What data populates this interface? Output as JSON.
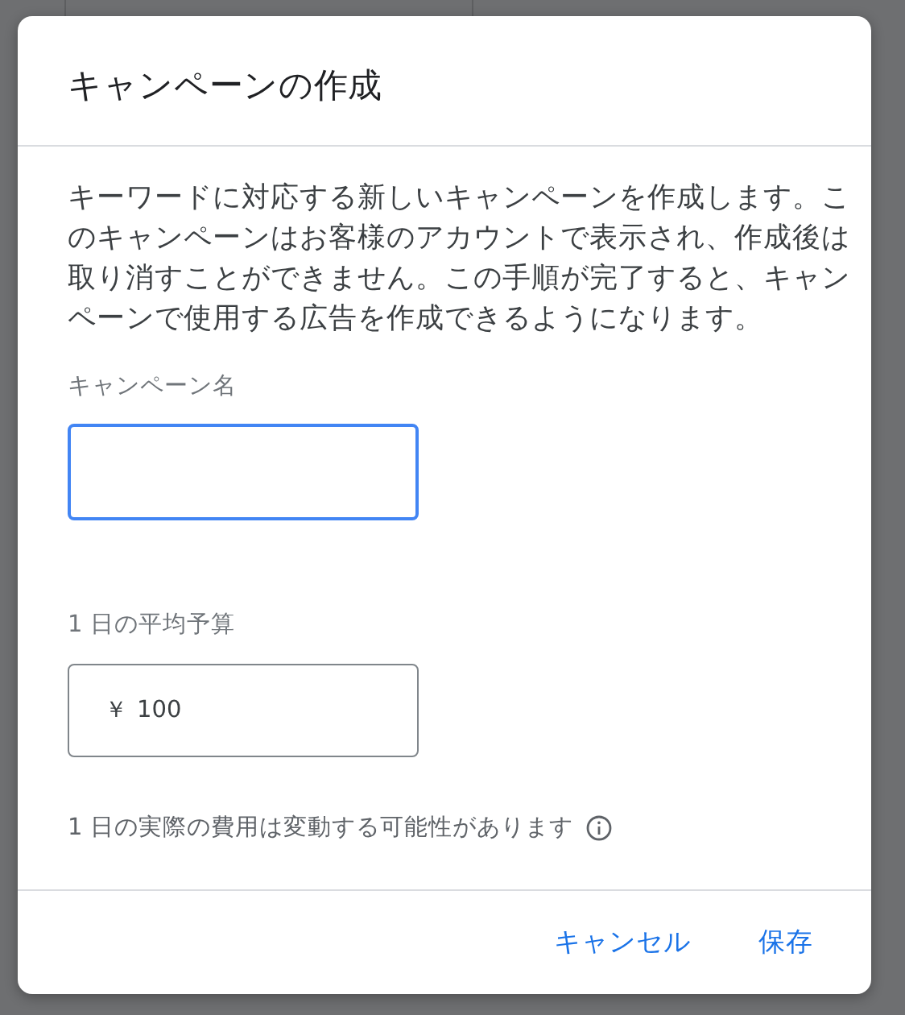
{
  "dialog": {
    "title": "キャンペーンの作成",
    "description": "キーワードに対応する新しいキャンペーンを作成します。このキャンペーンはお客様のアカウントで表示され、作成後は取り消すことができません。この手順が完了すると、キャンペーンで使用する広告を作成できるようになります。",
    "fields": [
      {
        "label": "キャンペーン名",
        "focused": true
      },
      {
        "label": "1 日の平均予算",
        "prefix": "￥",
        "value": "100",
        "focused": false
      }
    ],
    "note": "1 日の実際の費用は変動する可能性があります",
    "actions": [
      "キャンセル",
      "保存"
    ]
  }
}
